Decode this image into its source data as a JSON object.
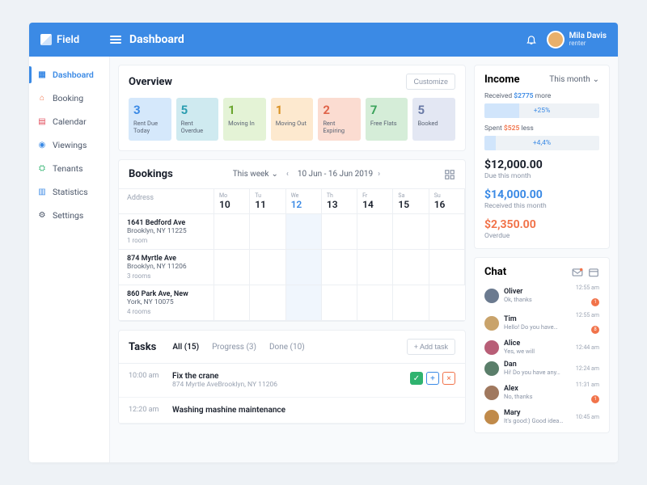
{
  "brand": "Field",
  "page_title": "Dashboard",
  "user": {
    "name": "Mila Davis",
    "role": "renter"
  },
  "sidebar": [
    {
      "label": "Dashboard",
      "icon": "▦",
      "color": "#3b8ae5",
      "active": true
    },
    {
      "label": "Booking",
      "icon": "⌂",
      "color": "#f1734a"
    },
    {
      "label": "Calendar",
      "icon": "▤",
      "color": "#e14b5a"
    },
    {
      "label": "Viewings",
      "icon": "◉",
      "color": "#3b8ae5"
    },
    {
      "label": "Tenants",
      "icon": "⛭",
      "color": "#2fb36f"
    },
    {
      "label": "Statistics",
      "icon": "▥",
      "color": "#3b8ae5"
    },
    {
      "label": "Settings",
      "icon": "⚙",
      "color": "#4a5568"
    }
  ],
  "overview": {
    "title": "Overview",
    "customize": "Customize",
    "stats": [
      {
        "num": "3",
        "label": "Rent Due Today",
        "bg": "#d5e8fb",
        "fg": "#3b8ae5"
      },
      {
        "num": "5",
        "label": "Rent Overdue",
        "bg": "#cfeaf0",
        "fg": "#2a9db0"
      },
      {
        "num": "1",
        "label": "Moving In",
        "bg": "#e4f3d6",
        "fg": "#6aa52e"
      },
      {
        "num": "1",
        "label": "Moving Out",
        "bg": "#fde9cf",
        "fg": "#d99021"
      },
      {
        "num": "2",
        "label": "Rent Expiring",
        "bg": "#fbdcd1",
        "fg": "#e0644a"
      },
      {
        "num": "7",
        "label": "Free Flats",
        "bg": "#d5edd8",
        "fg": "#3ba35b"
      },
      {
        "num": "5",
        "label": "Booked",
        "bg": "#e3e7f3",
        "fg": "#6a7aa6"
      }
    ]
  },
  "bookings": {
    "title": "Bookings",
    "period": "This week",
    "range": "10 Jun - 16 Jun 2019",
    "address_header": "Address",
    "days": [
      {
        "dow": "Mo",
        "date": "10"
      },
      {
        "dow": "Tu",
        "date": "11"
      },
      {
        "dow": "We",
        "date": "12",
        "today": true
      },
      {
        "dow": "Th",
        "date": "13"
      },
      {
        "dow": "Fr",
        "date": "14"
      },
      {
        "dow": "Sa",
        "date": "15"
      },
      {
        "dow": "Su",
        "date": "16"
      }
    ],
    "rows": [
      {
        "l1": "1641 Bedford Ave",
        "l2": "Brooklyn, NY 11225",
        "meta": "1 room"
      },
      {
        "l1": "874 Myrtle Ave",
        "l2": "Brooklyn, NY 11206",
        "meta": "3 rooms"
      },
      {
        "l1": "860 Park Ave, New",
        "l2": "York, NY 10075",
        "meta": "4 rooms"
      }
    ]
  },
  "tasks": {
    "title": "Tasks",
    "tabs": [
      {
        "label": "All (15)",
        "active": true
      },
      {
        "label": "Progress (3)"
      },
      {
        "label": "Done (10)"
      }
    ],
    "add_task": "+ Add task",
    "items": [
      {
        "time": "10:00 am",
        "title": "Fix the crane",
        "sub": "874 Myrtle AveBrooklyn, NY 11206",
        "actions": true
      },
      {
        "time": "12:20 am",
        "title": "Washing mashine maintenance",
        "sub": ""
      }
    ]
  },
  "income": {
    "title": "Income",
    "period": "This month",
    "received_label": "Received",
    "received_amt": "$2775",
    "received_suffix": "more",
    "received_bar_pct": 30,
    "received_bar_text": "+25%",
    "spent_label": "Spent",
    "spent_amt": "$525",
    "spent_suffix": "less",
    "spent_bar_pct": 10,
    "spent_bar_text": "+4,4%",
    "figures": [
      {
        "amount": "$12,000.00",
        "label": "Due this month",
        "color": "#1a202c"
      },
      {
        "amount": "$14,000.00",
        "label": "Received this month",
        "color": "#3b8ae5"
      },
      {
        "amount": "$2,350.00",
        "label": "Overdue",
        "color": "#f1734a"
      }
    ]
  },
  "chat": {
    "title": "Chat",
    "items": [
      {
        "name": "Oliver",
        "msg": "Ok, thanks",
        "time": "12:55 am",
        "badge": 1,
        "av": "#6b7a8f"
      },
      {
        "name": "Tim",
        "msg": "Hello! Do you have…",
        "time": "12:55 am",
        "badge": 8,
        "av": "#c9a36b"
      },
      {
        "name": "Alice",
        "msg": "Yes, we will",
        "time": "12:44 am",
        "av": "#b85e77"
      },
      {
        "name": "Dan",
        "msg": "Hi! Do you have any…",
        "time": "12:24 am",
        "av": "#5a7e6a"
      },
      {
        "name": "Alex",
        "msg": "No, thanks",
        "time": "11:31 am",
        "badge": 1,
        "av": "#a0785e"
      },
      {
        "name": "Mary",
        "msg": "It's good:) Good idea…",
        "time": "10:45 am",
        "av": "#c08a4a"
      }
    ]
  }
}
